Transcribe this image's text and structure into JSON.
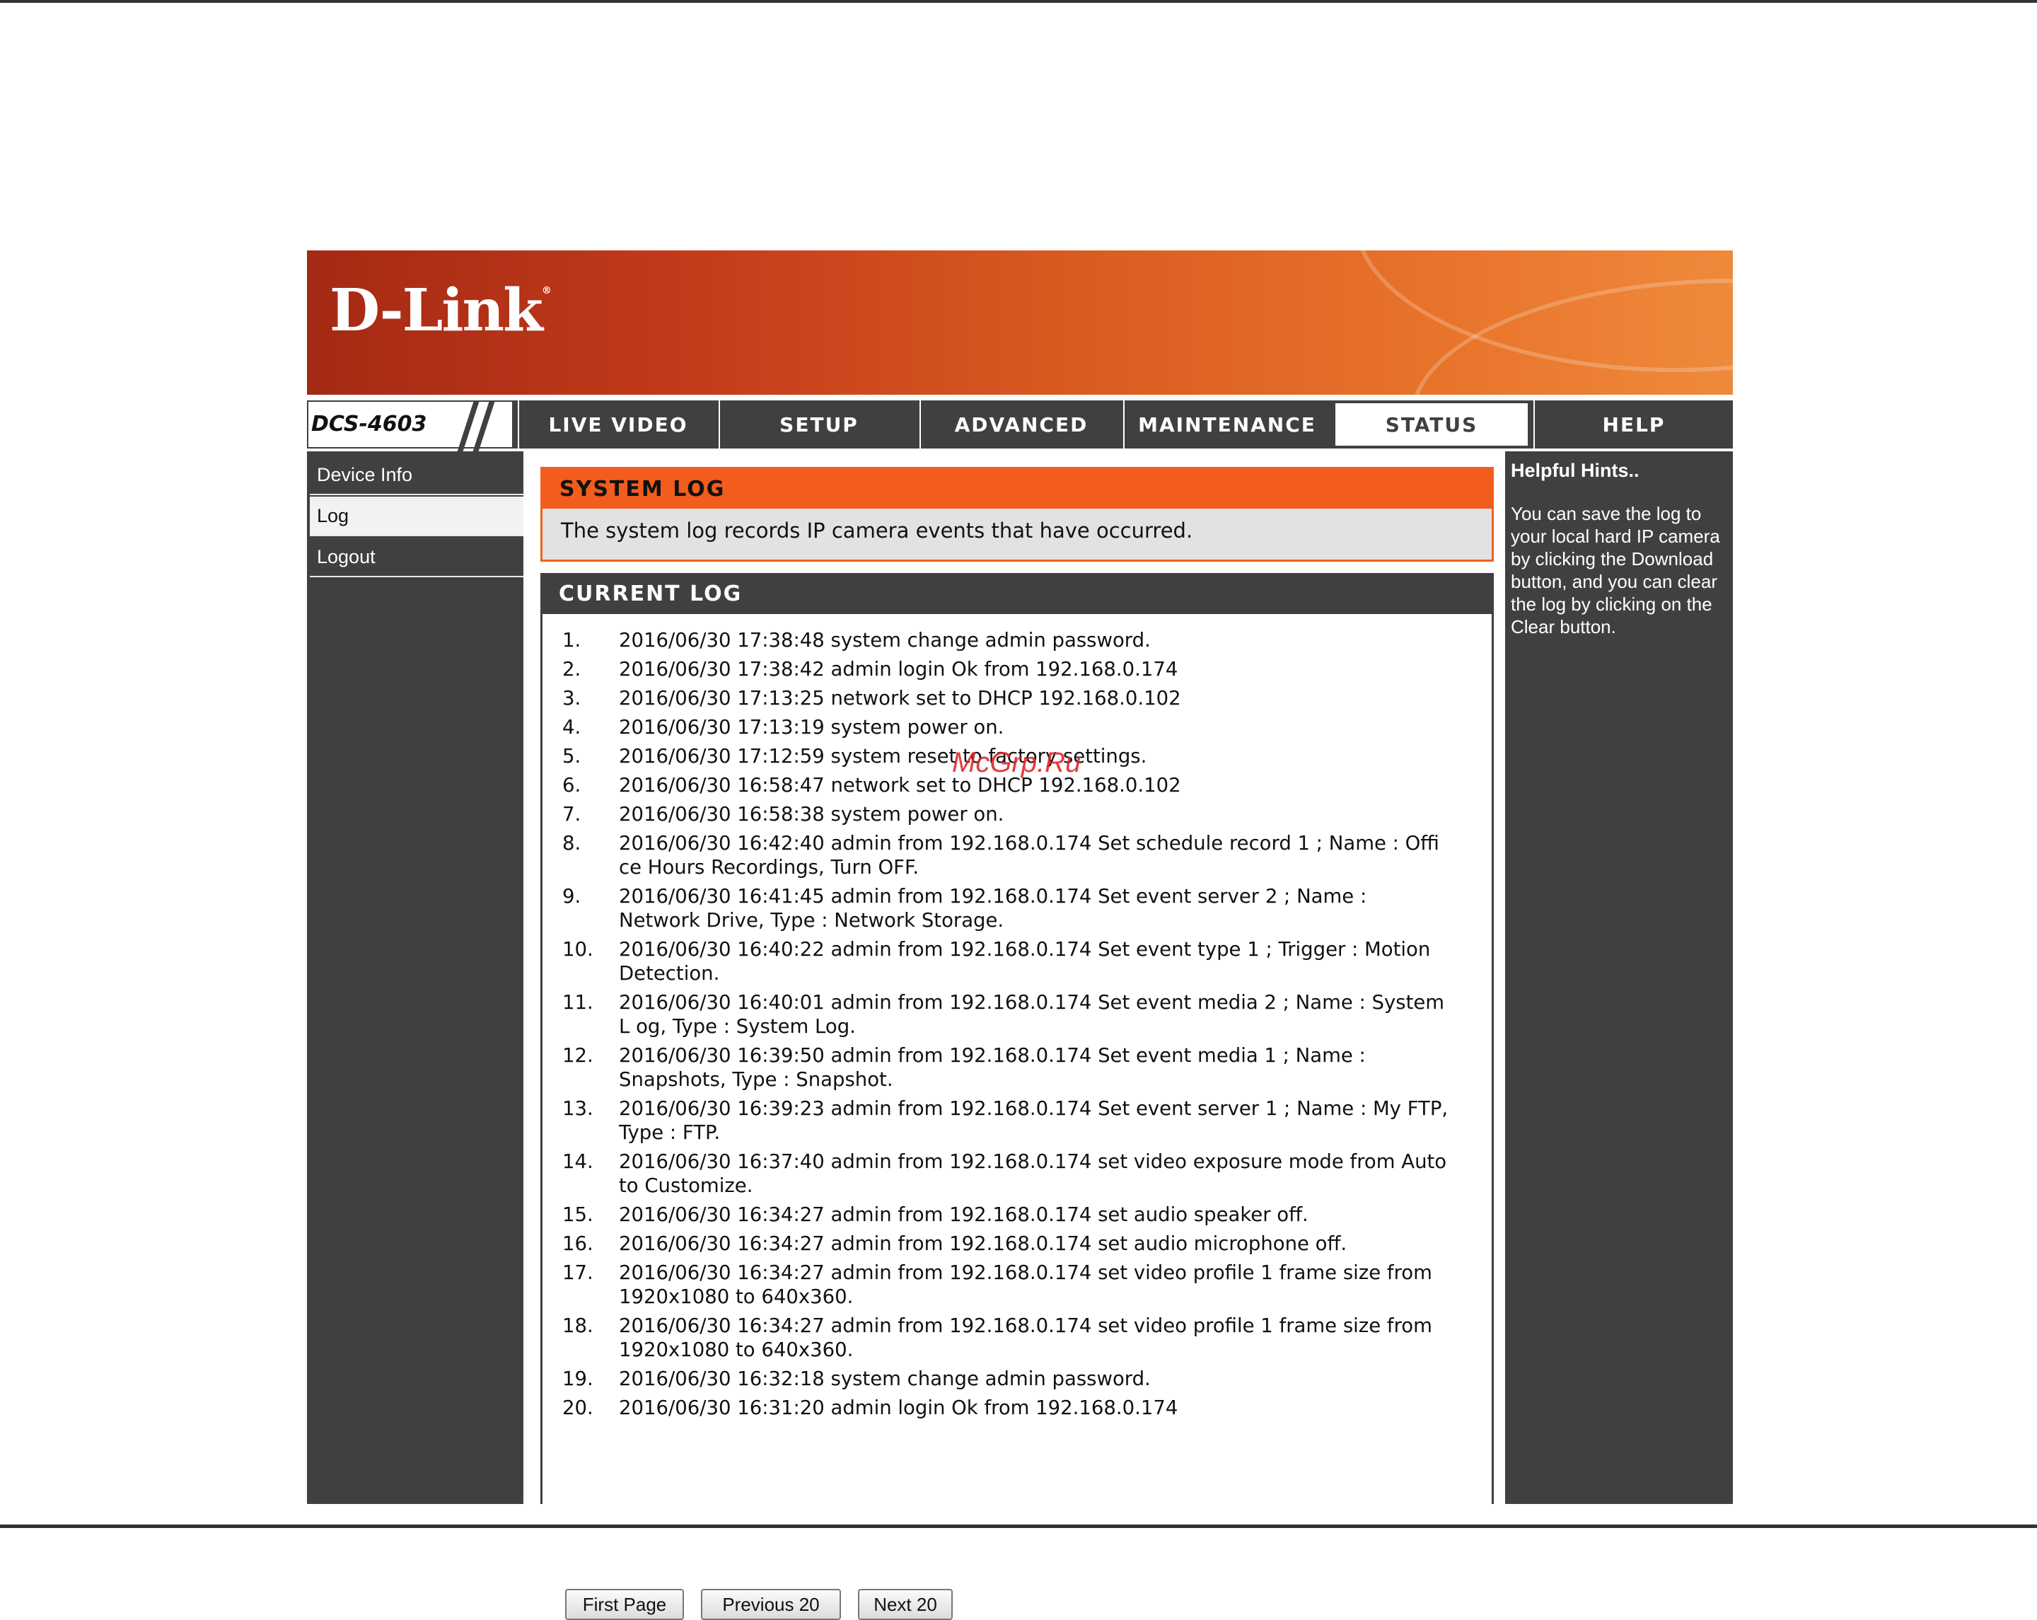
{
  "brand": {
    "logo": "D-Link",
    "registered_mark": "®"
  },
  "model": "DCS-4603",
  "nav": {
    "tabs": [
      {
        "label": "LIVE VIDEO"
      },
      {
        "label": "SETUP"
      },
      {
        "label": "ADVANCED"
      },
      {
        "label": "MAINTENANCE"
      },
      {
        "label": "STATUS",
        "active": true
      },
      {
        "label": "HELP"
      }
    ]
  },
  "sidebar": {
    "items": [
      {
        "label": "Device Info"
      },
      {
        "label": "Log",
        "active": true
      },
      {
        "label": "Logout"
      }
    ]
  },
  "system_log": {
    "title": "SYSTEM LOG",
    "description": "The system log records IP camera events that have occurred."
  },
  "current_log": {
    "title": "CURRENT LOG",
    "entries": [
      {
        "num": "1.",
        "text": "2016/06/30 17:38:48 system change admin password."
      },
      {
        "num": "2.",
        "text": "2016/06/30 17:38:42 admin login Ok from 192.168.0.174"
      },
      {
        "num": "3.",
        "text": "2016/06/30 17:13:25 network set to DHCP 192.168.0.102"
      },
      {
        "num": "4.",
        "text": "2016/06/30 17:13:19 system power on."
      },
      {
        "num": "5.",
        "text": "2016/06/30 17:12:59 system reset to factory settings."
      },
      {
        "num": "6.",
        "text": "2016/06/30 16:58:47 network set to DHCP 192.168.0.102"
      },
      {
        "num": "7.",
        "text": "2016/06/30 16:58:38 system power on."
      },
      {
        "num": "8.",
        "text": "2016/06/30 16:42:40 admin from 192.168.0.174 Set schedule record 1 ; Name : Offi ce Hours Recordings, Turn OFF."
      },
      {
        "num": "9.",
        "text": "2016/06/30 16:41:45 admin from 192.168.0.174 Set event server 2 ; Name : Network Drive, Type : Network Storage."
      },
      {
        "num": "10.",
        "text": "2016/06/30 16:40:22 admin from 192.168.0.174 Set event type 1 ; Trigger : Motion Detection."
      },
      {
        "num": "11.",
        "text": "2016/06/30 16:40:01 admin from 192.168.0.174 Set event media 2 ; Name : System L og, Type : System Log."
      },
      {
        "num": "12.",
        "text": "2016/06/30 16:39:50 admin from 192.168.0.174 Set event media 1 ; Name : Snapshots, Type : Snapshot."
      },
      {
        "num": "13.",
        "text": "2016/06/30 16:39:23 admin from 192.168.0.174 Set event server 1 ; Name : My FTP, Type : FTP."
      },
      {
        "num": "14.",
        "text": "2016/06/30 16:37:40 admin from 192.168.0.174 set video exposure mode from Auto to Customize."
      },
      {
        "num": "15.",
        "text": "2016/06/30 16:34:27 admin from 192.168.0.174 set audio speaker off."
      },
      {
        "num": "16.",
        "text": "2016/06/30 16:34:27 admin from 192.168.0.174 set audio microphone off."
      },
      {
        "num": "17.",
        "text": "2016/06/30 16:34:27 admin from 192.168.0.174 set video profile 1 frame size from 1920x1080 to 640x360."
      },
      {
        "num": "18.",
        "text": "2016/06/30 16:34:27 admin from 192.168.0.174 set video profile 1 frame size from 1920x1080 to 640x360."
      },
      {
        "num": "19.",
        "text": "2016/06/30 16:32:18 system change admin password."
      },
      {
        "num": "20.",
        "text": "2016/06/30 16:31:20 admin login Ok from 192.168.0.174"
      }
    ]
  },
  "buttons": {
    "first_page": "First Page",
    "previous": "Previous 20",
    "next": "Next 20"
  },
  "hints": {
    "title": "Helpful Hints..",
    "text": "You can save the log to your local hard IP camera by clicking the Download button, and you can clear the log by clicking on the Clear button."
  },
  "watermark": "McGrp.Ru",
  "colors": {
    "accent_orange": "#f25c1c",
    "dark_gray": "#404040"
  }
}
